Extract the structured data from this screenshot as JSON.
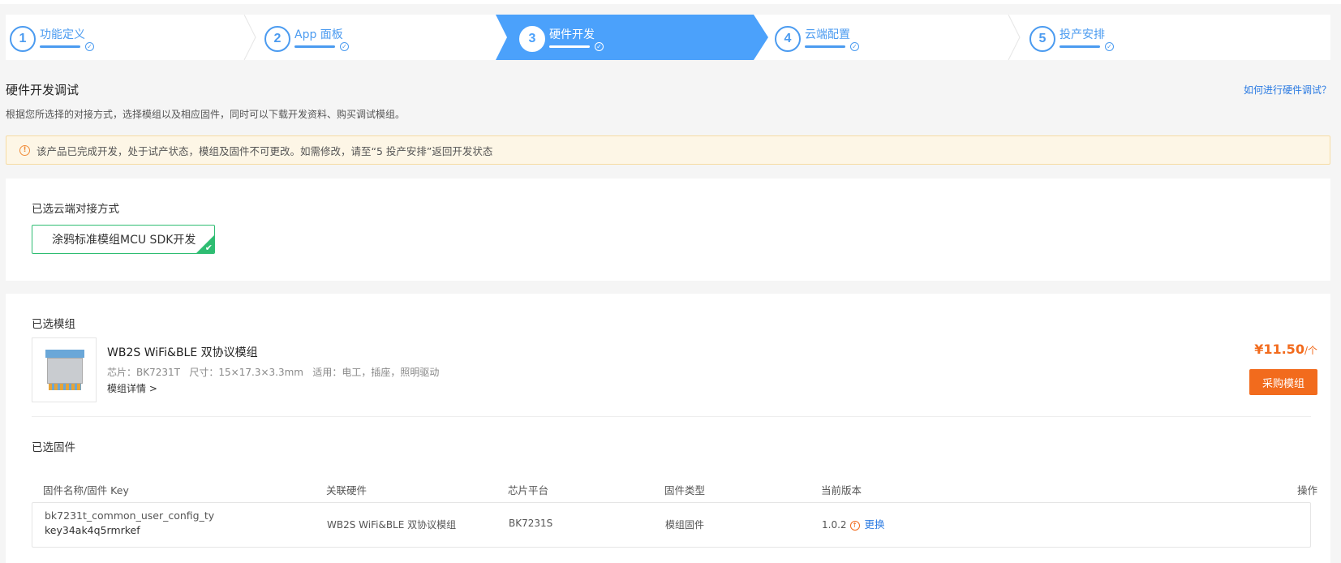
{
  "steps": [
    {
      "num": "1",
      "label": "功能定义"
    },
    {
      "num": "2",
      "label": "App 面板"
    },
    {
      "num": "3",
      "label": "硬件开发"
    },
    {
      "num": "4",
      "label": "云端配置"
    },
    {
      "num": "5",
      "label": "投产安排"
    }
  ],
  "active_step": 3,
  "page": {
    "title": "硬件开发调试",
    "help_link": "如何进行硬件调试？",
    "subtitle": "根据您所选择的对接方式，选择模组以及相应固件，同时可以下载开发资料、购买调试模组。",
    "notice": "该产品已完成开发，处于试产状态，模组及固件不可更改。如需修改，请至“5 投产安排”返回开发状态"
  },
  "cloud": {
    "heading": "已选云端对接方式",
    "option": "涂鸦标准模组MCU SDK开发"
  },
  "module": {
    "heading": "已选模组",
    "name": "WB2S WiFi&BLE 双协议模组",
    "spec": "芯片：BK7231T   尺寸：15×17.3×3.3mm   适用：电工，插座，照明驱动",
    "detail": "模组详情 >",
    "price": "¥11.50",
    "price_unit": "/个",
    "buy_label": "采购模组"
  },
  "firmware": {
    "heading": "已选固件",
    "columns": [
      "固件名称/固件 Key",
      "关联硬件",
      "芯片平台",
      "固件类型",
      "当前版本",
      "操作"
    ],
    "row": {
      "name": "bk7231t_common_user_config_ty",
      "key": "key34ak4q5rmrkef",
      "hardware": "WB2S WiFi&BLE 双协议模组",
      "chip": "BK7231S",
      "type": "模组固件",
      "version": "1.0.2",
      "action": "更换"
    }
  },
  "colors": {
    "accent": "#4ba1fb",
    "success": "#2ebd72",
    "warning": "#f26b1d",
    "link": "#2a7ae2"
  }
}
